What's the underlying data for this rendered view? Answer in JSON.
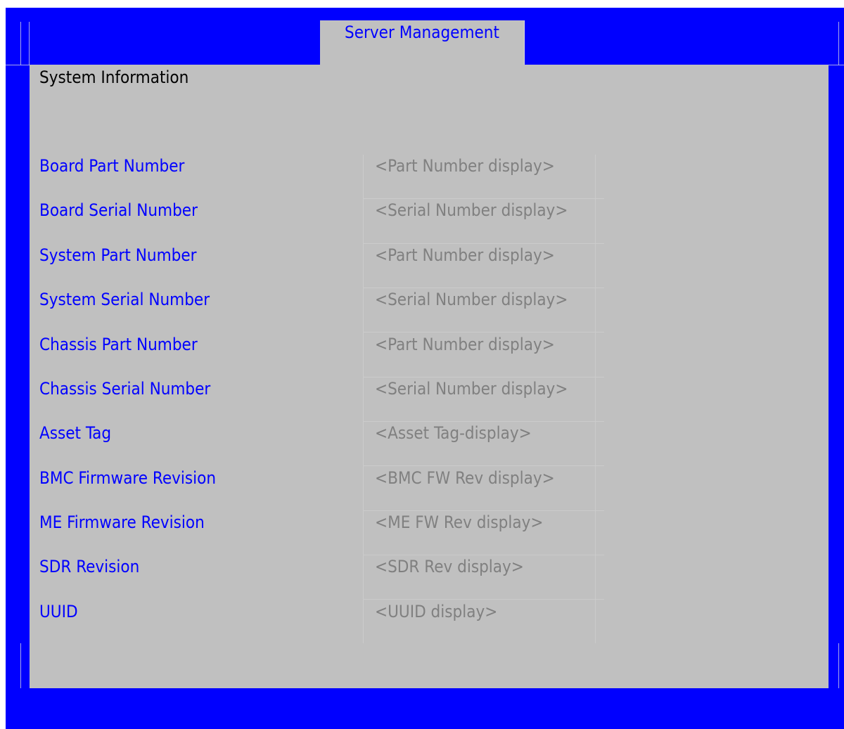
{
  "tab": {
    "label": "Server Management"
  },
  "page": {
    "title": "System Information"
  },
  "rows": [
    {
      "label": "Board Part Number",
      "value": "<Part Number display>"
    },
    {
      "label": "Board Serial Number",
      "value": "<Serial Number display>"
    },
    {
      "label": "System Part Number",
      "value": "<Part Number display>"
    },
    {
      "label": "System Serial Number",
      "value": "<Serial Number display>"
    },
    {
      "label": "Chassis Part Number",
      "value": "<Part Number display>"
    },
    {
      "label": "Chassis Serial Number",
      "value": "<Serial Number display>"
    },
    {
      "label": "Asset Tag",
      "value": "<Asset Tag-display>"
    },
    {
      "label": "BMC Firmware Revision",
      "value": "<BMC FW Rev display>"
    },
    {
      "label": "ME Firmware Revision",
      "value": "<ME FW Rev display>"
    },
    {
      "label": "SDR Revision",
      "value": "<SDR Rev display>"
    },
    {
      "label": "UUID",
      "value": "<UUID display>"
    }
  ],
  "colors": {
    "frame": "#0000ff",
    "panel": "#c0c0c0",
    "label": "#0000ff",
    "value": "#808080",
    "title": "#000000"
  }
}
